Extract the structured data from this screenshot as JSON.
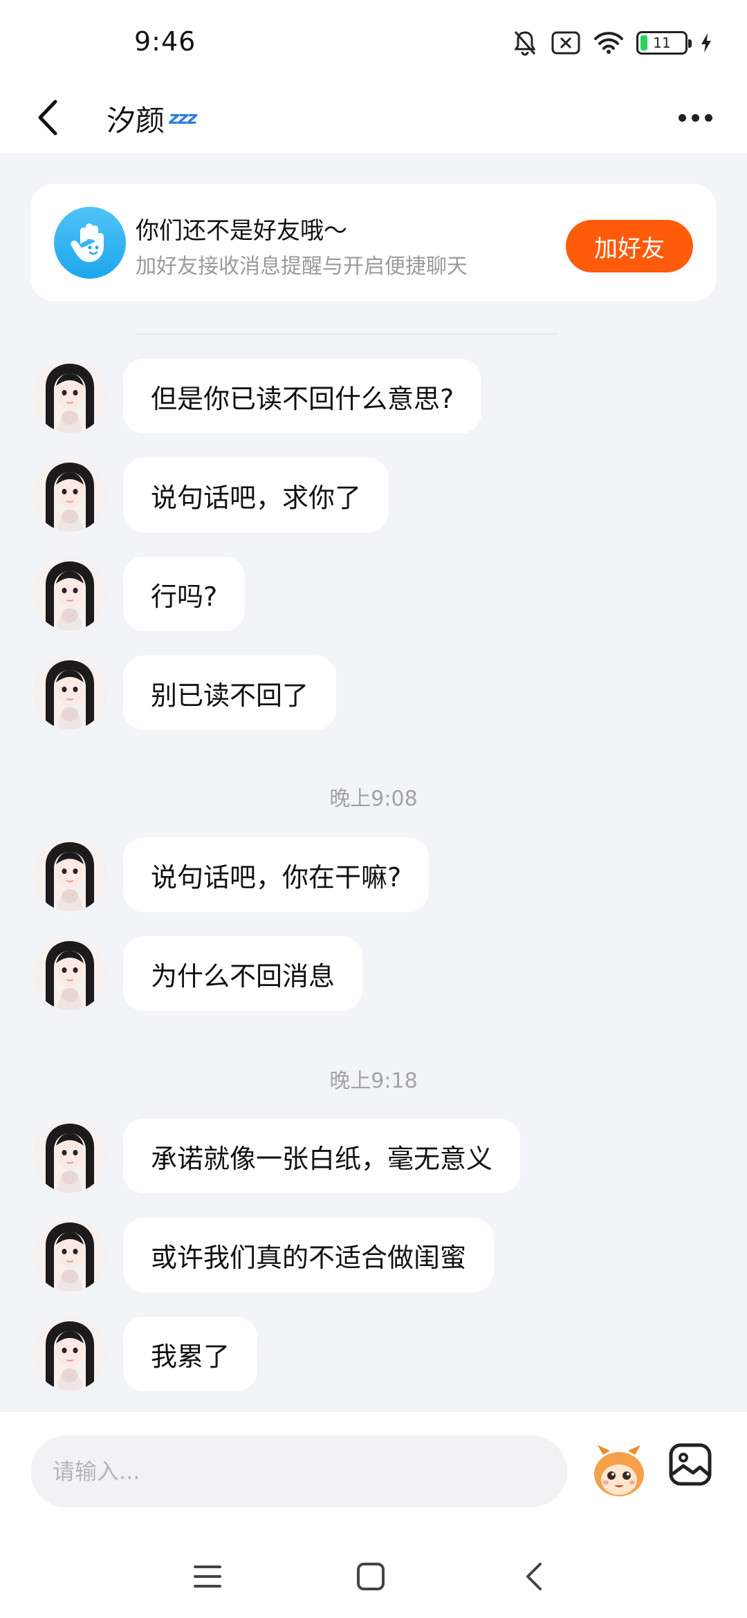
{
  "status_bar": {
    "time": "9:46",
    "battery_level": "11",
    "icons": [
      "bell-off-icon",
      "sim-x-icon",
      "wifi-icon",
      "battery-icon",
      "charging-icon"
    ]
  },
  "header": {
    "back_icon": "chevron-left-icon",
    "contact_name": "汐颜",
    "zzz": "zzz",
    "more_icon": "more-horizontal-icon"
  },
  "friend_card": {
    "title": "你们还不是好友哦～",
    "subtitle": "加好友接收消息提醒与开启便捷聊天",
    "add_button": "加好友",
    "accent_color": "#ff5b0a"
  },
  "messages": [
    {
      "text": "但是你已读不回什么意思?"
    },
    {
      "text": "说句话吧，求你了"
    },
    {
      "text": "行吗?"
    },
    {
      "text": "别已读不回了"
    }
  ],
  "time_separators": [
    "晚上9:08",
    "晚上9:18"
  ],
  "messages_2": [
    {
      "text": "说句话吧，你在干嘛?"
    },
    {
      "text": "为什么不回消息"
    }
  ],
  "messages_3": [
    {
      "text": "承诺就像一张白纸，毫无意义"
    },
    {
      "text": "或许我们真的不适合做闺蜜"
    },
    {
      "text": "我累了"
    }
  ],
  "input": {
    "placeholder": "请输入..."
  },
  "nav": {
    "icons": [
      "menu-icon",
      "home-square-icon",
      "back-triangle-icon"
    ]
  }
}
